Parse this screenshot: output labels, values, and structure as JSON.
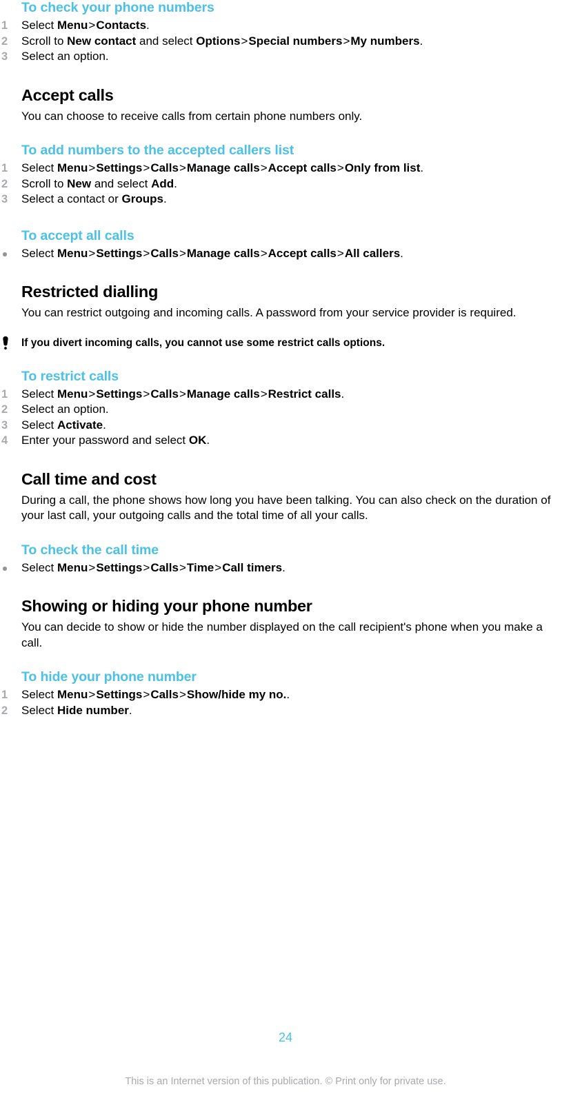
{
  "document": {
    "page_number": "24",
    "footer_note": "This is an Internet version of this publication. © Print only for private use.",
    "accent_color": "#4BC1E5",
    "marker_color": "#A7A9AC"
  },
  "blocks": {
    "check_numbers": {
      "heading": "To check your phone numbers",
      "steps": [
        {
          "marker": "1",
          "prefix": "Select ",
          "parts": [
            "Menu",
            "Contacts"
          ],
          "suffix": "."
        },
        {
          "marker": "2",
          "prefix": "Scroll to ",
          "parts": [
            "New contact"
          ],
          "mid": " and select ",
          "parts2": [
            "Options",
            "Special numbers",
            "My numbers"
          ],
          "suffix": "."
        },
        {
          "marker": "3",
          "prefix": "Select an option.",
          "parts": [],
          "suffix": ""
        }
      ]
    },
    "accept_calls": {
      "heading": "Accept calls",
      "body": "You can choose to receive calls from certain phone numbers only.",
      "proc_add": {
        "heading": "To add numbers to the accepted callers list",
        "s1_prefix": "Select ",
        "s1_parts": [
          "Menu",
          "Settings",
          "Calls",
          "Manage calls",
          "Accept calls",
          "Only from list"
        ],
        "s1_suffix": ".",
        "s1_marker": "1",
        "s2_marker": "2",
        "s2_prefix": "Scroll to ",
        "s2_bold_a": "New",
        "s2_mid": " and select ",
        "s2_bold_b": "Add",
        "s2_suffix": ".",
        "s3_marker": "3",
        "s3_prefix": "Select a contact or ",
        "s3_bold": "Groups",
        "s3_suffix": "."
      },
      "proc_all": {
        "heading": "To accept all calls",
        "marker": "•",
        "prefix": "Select ",
        "parts": [
          "Menu",
          "Settings",
          "Calls",
          "Manage calls",
          "Accept calls",
          "All callers"
        ],
        "suffix": "."
      }
    },
    "restricted_dialling": {
      "heading": "Restricted dialling",
      "body": "You can restrict outgoing and incoming calls. A password from your service provider is required.",
      "note_icon": "exclamation-icon",
      "note": "If you divert incoming calls, you cannot use some restrict calls options.",
      "proc": {
        "heading": "To restrict calls",
        "s1_marker": "1",
        "s1_prefix": "Select ",
        "s1_parts": [
          "Menu",
          "Settings",
          "Calls",
          "Manage calls",
          "Restrict calls"
        ],
        "s1_suffix": ".",
        "s2_marker": "2",
        "s2_text": "Select an option.",
        "s3_marker": "3",
        "s3_prefix": "Select ",
        "s3_bold": "Activate",
        "s3_suffix": ".",
        "s4_marker": "4",
        "s4_prefix": "Enter your password and select ",
        "s4_bold": "OK",
        "s4_suffix": "."
      }
    },
    "call_time": {
      "heading": "Call time and cost",
      "body": "During a call, the phone shows how long you have been talking. You can also check on the duration of your last call, your outgoing calls and the total time of all your calls.",
      "proc": {
        "heading": "To check the call time",
        "marker": "•",
        "prefix": "Select ",
        "parts": [
          "Menu",
          "Settings",
          "Calls",
          "Time",
          "Call timers"
        ],
        "suffix": "."
      }
    },
    "show_hide_number": {
      "heading": "Showing or hiding your phone number",
      "body": "You can decide to show or hide the number displayed on the call recipient's phone when you make a call.",
      "proc": {
        "heading": "To hide your phone number",
        "s1_marker": "1",
        "s1_prefix": "Select ",
        "s1_parts": [
          "Menu",
          "Settings",
          "Calls",
          "Show/hide my no."
        ],
        "s1_suffix": ".",
        "s2_marker": "2",
        "s2_prefix": "Select ",
        "s2_bold": "Hide number",
        "s2_suffix": "."
      }
    }
  },
  "separators": {
    "chevron": ">"
  }
}
